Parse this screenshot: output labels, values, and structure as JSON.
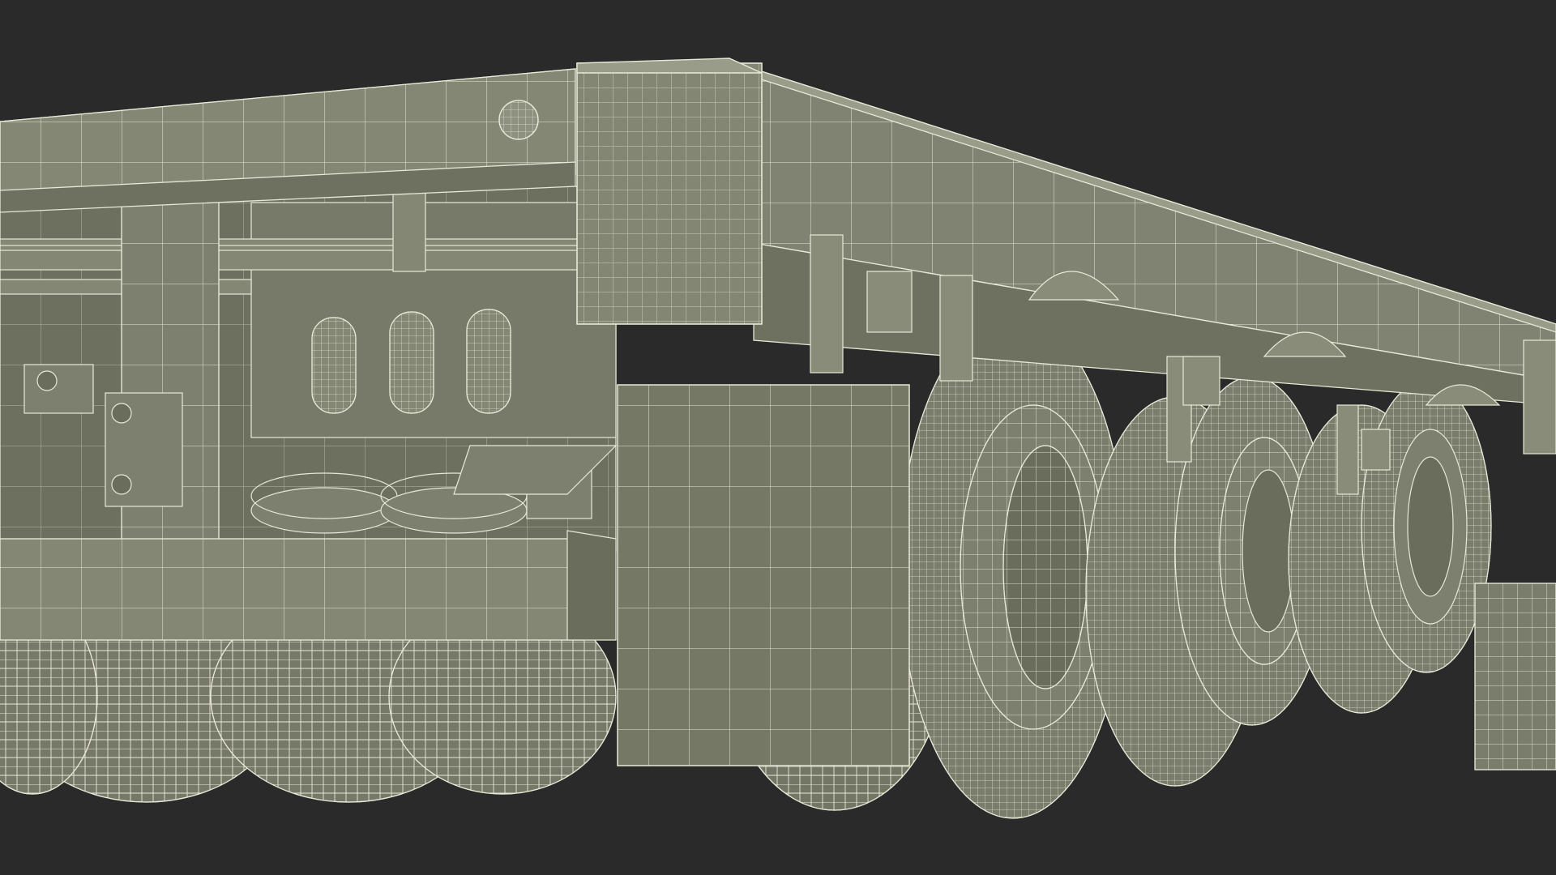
{
  "scene": {
    "background": "#2a2a2a",
    "model_fill": "#7b7d6c",
    "model_fill_dark": "#6a6c5c",
    "wire_color": "#e8e8d8",
    "subject": "trailer-chassis-wireframe"
  }
}
